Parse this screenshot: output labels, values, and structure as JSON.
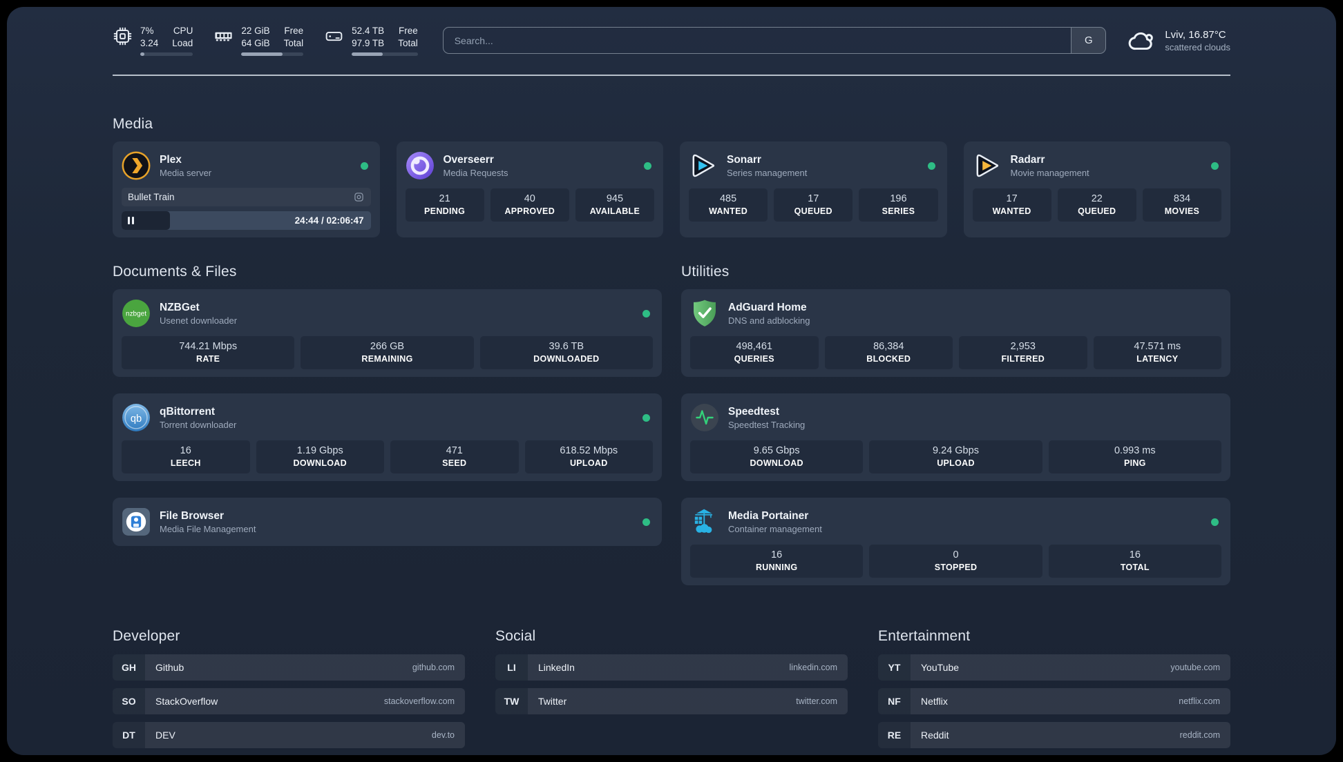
{
  "header": {
    "resources": [
      {
        "values": [
          "7%",
          "3.24"
        ],
        "labels": [
          "CPU",
          "Load"
        ],
        "progress": 8
      },
      {
        "values": [
          "22 GiB",
          "64 GiB"
        ],
        "labels": [
          "Free",
          "Total"
        ],
        "progress": 66
      },
      {
        "values": [
          "52.4 TB",
          "97.9 TB"
        ],
        "labels": [
          "Free",
          "Total"
        ],
        "progress": 47
      }
    ],
    "search": {
      "placeholder": "Search...",
      "provider": "G"
    },
    "weather": {
      "location": "Lviv, 16.87°C",
      "condition": "scattered clouds"
    }
  },
  "groups": {
    "media": {
      "title": "Media",
      "services": [
        {
          "name": "Plex",
          "desc": "Media server",
          "status": "online",
          "now_playing": {
            "title": "Bullet Train",
            "time": "24:44 / 02:06:47",
            "progress": 19.5
          }
        },
        {
          "name": "Overseerr",
          "desc": "Media Requests",
          "status": "online",
          "stats": [
            {
              "value": "21",
              "label": "PENDING"
            },
            {
              "value": "40",
              "label": "APPROVED"
            },
            {
              "value": "945",
              "label": "AVAILABLE"
            }
          ]
        },
        {
          "name": "Sonarr",
          "desc": "Series management",
          "status": "online",
          "stats": [
            {
              "value": "485",
              "label": "WANTED"
            },
            {
              "value": "17",
              "label": "QUEUED"
            },
            {
              "value": "196",
              "label": "SERIES"
            }
          ]
        },
        {
          "name": "Radarr",
          "desc": "Movie management",
          "status": "online",
          "stats": [
            {
              "value": "17",
              "label": "WANTED"
            },
            {
              "value": "22",
              "label": "QUEUED"
            },
            {
              "value": "834",
              "label": "MOVIES"
            }
          ]
        }
      ]
    },
    "documents": {
      "title": "Documents & Files",
      "services": [
        {
          "name": "NZBGet",
          "desc": "Usenet downloader",
          "status": "online",
          "stats": [
            {
              "value": "744.21 Mbps",
              "label": "RATE"
            },
            {
              "value": "266 GB",
              "label": "REMAINING"
            },
            {
              "value": "39.6 TB",
              "label": "DOWNLOADED"
            }
          ]
        },
        {
          "name": "qBittorrent",
          "desc": "Torrent downloader",
          "status": "online",
          "stats": [
            {
              "value": "16",
              "label": "LEECH"
            },
            {
              "value": "1.19 Gbps",
              "label": "DOWNLOAD"
            },
            {
              "value": "471",
              "label": "SEED"
            },
            {
              "value": "618.52 Mbps",
              "label": "UPLOAD"
            }
          ]
        },
        {
          "name": "File Browser",
          "desc": "Media File Management",
          "status": "online"
        }
      ]
    },
    "utilities": {
      "title": "Utilities",
      "services": [
        {
          "name": "AdGuard Home",
          "desc": "DNS and adblocking",
          "status": "none",
          "stats": [
            {
              "value": "498,461",
              "label": "QUERIES"
            },
            {
              "value": "86,384",
              "label": "BLOCKED"
            },
            {
              "value": "2,953",
              "label": "FILTERED"
            },
            {
              "value": "47.571 ms",
              "label": "LATENCY"
            }
          ]
        },
        {
          "name": "Speedtest",
          "desc": "Speedtest Tracking",
          "status": "none",
          "stats": [
            {
              "value": "9.65 Gbps",
              "label": "DOWNLOAD"
            },
            {
              "value": "9.24 Gbps",
              "label": "UPLOAD"
            },
            {
              "value": "0.993 ms",
              "label": "PING"
            }
          ]
        },
        {
          "name": "Media Portainer",
          "desc": "Container management",
          "status": "online",
          "stats": [
            {
              "value": "16",
              "label": "RUNNING"
            },
            {
              "value": "0",
              "label": "STOPPED"
            },
            {
              "value": "16",
              "label": "TOTAL"
            }
          ]
        }
      ]
    }
  },
  "bookmarks": {
    "developer": {
      "title": "Developer",
      "items": [
        {
          "abbr": "GH",
          "name": "Github",
          "url": "github.com"
        },
        {
          "abbr": "SO",
          "name": "StackOverflow",
          "url": "stackoverflow.com"
        },
        {
          "abbr": "DT",
          "name": "DEV",
          "url": "dev.to"
        }
      ]
    },
    "social": {
      "title": "Social",
      "items": [
        {
          "abbr": "LI",
          "name": "LinkedIn",
          "url": "linkedin.com"
        },
        {
          "abbr": "TW",
          "name": "Twitter",
          "url": "twitter.com"
        }
      ]
    },
    "entertainment": {
      "title": "Entertainment",
      "items": [
        {
          "abbr": "YT",
          "name": "YouTube",
          "url": "youtube.com"
        },
        {
          "abbr": "NF",
          "name": "Netflix",
          "url": "netflix.com"
        },
        {
          "abbr": "RE",
          "name": "Reddit",
          "url": "reddit.com"
        }
      ]
    }
  },
  "colors": {
    "status_online": "#2ebd85",
    "accent_plex": "#eba42b",
    "accent_sonarr": "#33c2f1",
    "accent_radarr": "#f5b63c"
  }
}
